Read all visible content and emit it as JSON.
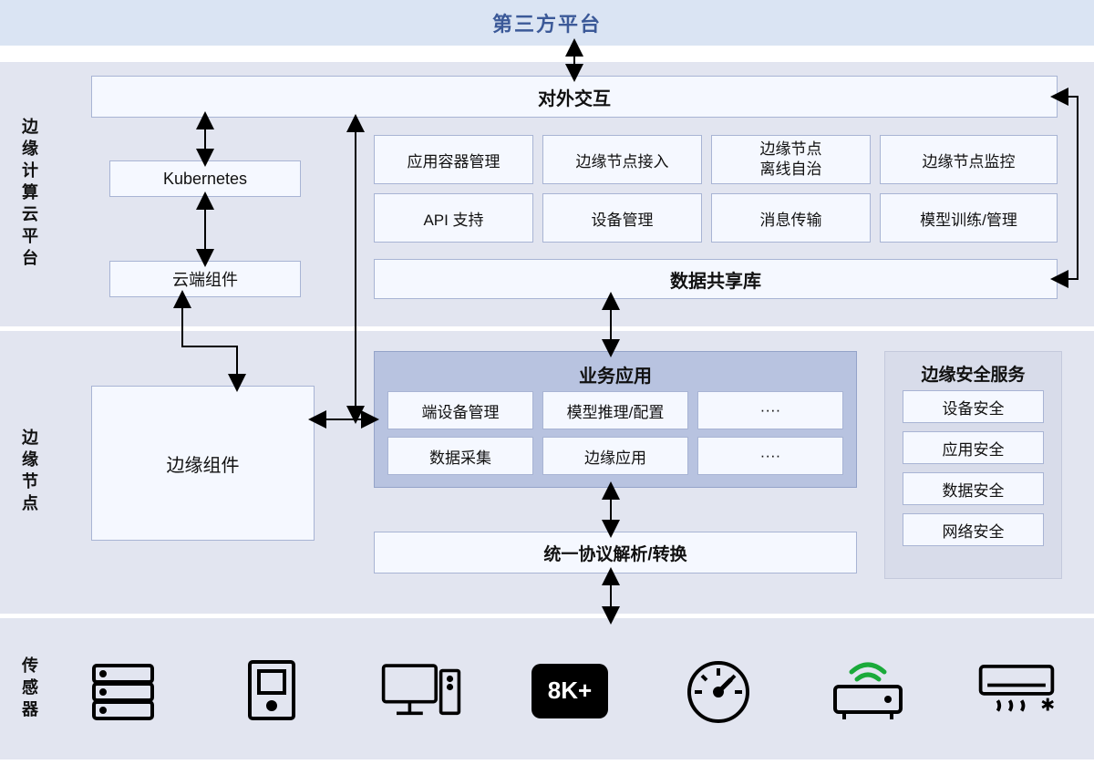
{
  "top": {
    "title": "第三方平台"
  },
  "cloud": {
    "sideLabel": "边缘计算云平台",
    "external": "对外交互",
    "k8s": "Kubernetes",
    "cloudComp": "云端组件",
    "grid": [
      "应用容器管理",
      "边缘节点接入",
      "边缘节点\n离线自治",
      "边缘节点监控",
      "API 支持",
      "设备管理",
      "消息传输",
      "模型训练/管理"
    ],
    "shared": "数据共享库"
  },
  "edge": {
    "sideLabel": "边缘节点",
    "edgeComp": "边缘组件",
    "bizTitle": "业务应用",
    "bizGrid": [
      "端设备管理",
      "模型推理/配置",
      "····",
      "数据采集",
      "边缘应用",
      "····"
    ],
    "protocol": "统一协议解析/转换",
    "secTitle": "边缘安全服务",
    "secItems": [
      "设备安全",
      "应用安全",
      "数据安全",
      "网络安全"
    ]
  },
  "sensor": {
    "sideLabel": "传感器"
  }
}
